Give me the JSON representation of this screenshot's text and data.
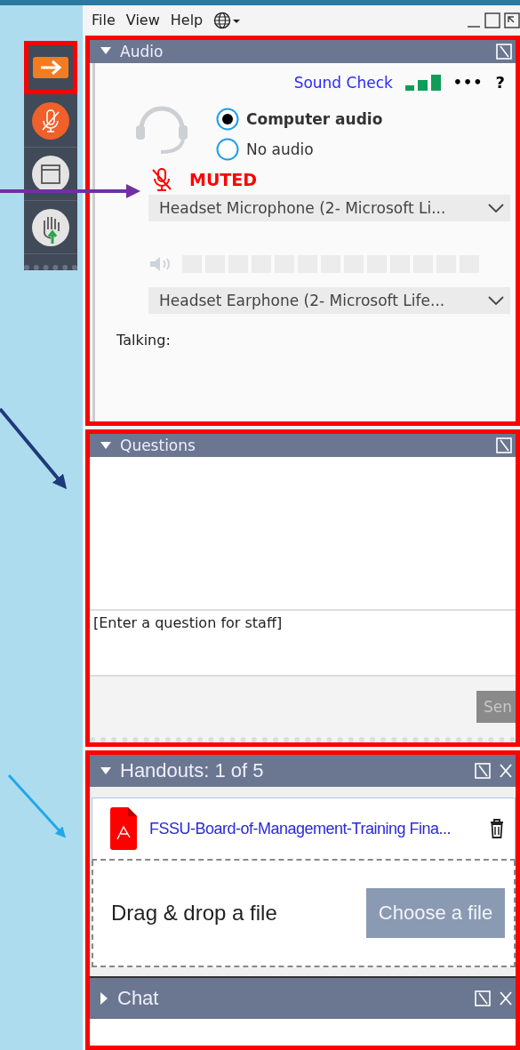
{
  "menu": [
    {
      "label": "File"
    },
    {
      "label": "View"
    },
    {
      "label": "Help"
    }
  ],
  "toolbar": [
    {
      "kind": "share",
      "highlighted": true
    },
    {
      "kind": "mic",
      "highlighted": false
    },
    {
      "kind": "screen",
      "highlighted": false
    },
    {
      "kind": "hand",
      "highlighted": false
    }
  ],
  "audio": {
    "title": "Audio",
    "expanded": true,
    "highlighted": true,
    "sound_check": "Sound Check",
    "more": "•••",
    "help": "?",
    "options": [
      {
        "label": "Computer audio",
        "selected": true
      },
      {
        "label": "No audio",
        "selected": false
      }
    ],
    "mic_status": {
      "label": "MUTED",
      "muted": true
    },
    "microphone": "Headset Microphone (2- Microsoft Li...",
    "speaker": "Headset Earphone (2- Microsoft Life...",
    "talking_label": "Talking:"
  },
  "questions": {
    "title": "Questions",
    "expanded": true,
    "highlighted": true,
    "placeholder": "[Enter a question for staff]",
    "send": {
      "label": "Sen",
      "disabled": true
    }
  },
  "files_group": {
    "highlighted": true,
    "handouts": {
      "title": "Handouts: 1 of 5",
      "expanded": true,
      "files": [
        {
          "name": "FSSU-Board-of-Management-Training Fina..."
        }
      ],
      "drop_text": "Drag & drop a file",
      "choose": "Choose a file"
    },
    "chat": {
      "title": "Chat",
      "expanded": false
    }
  }
}
